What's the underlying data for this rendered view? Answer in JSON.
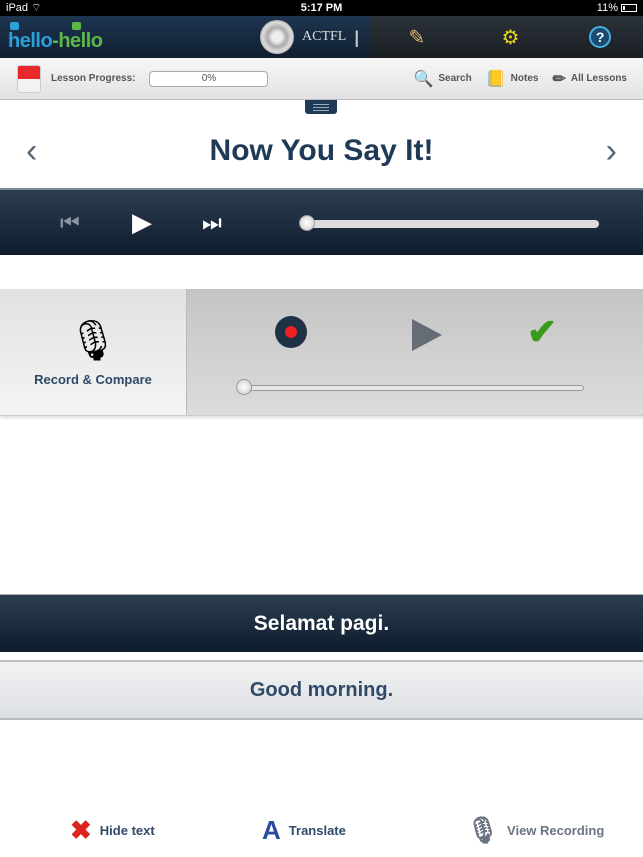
{
  "status_bar": {
    "device": "iPad",
    "time": "5:17 PM",
    "battery": "11%"
  },
  "app": {
    "logo_part1": "hello",
    "logo_dash": "-",
    "logo_part2": "hello",
    "partner": "ACTFL",
    "partner_bars": "|||"
  },
  "toolbar": {
    "lesson_progress_label": "Lesson Progress:",
    "lesson_progress_value": "0%",
    "lesson_progress_fraction": 0,
    "search_label": "Search",
    "notes_label": "Notes",
    "all_lessons_label": "All Lessons"
  },
  "title": {
    "text": "Now You Say It!",
    "prev": "‹",
    "next": "›"
  },
  "player": {
    "position_fraction": 0
  },
  "record_compare": {
    "label": "Record & Compare",
    "position_fraction": 0
  },
  "phrase": {
    "target": "Selamat pagi.",
    "translation": "Good morning."
  },
  "bottom": {
    "hide_text": "Hide text",
    "translate": "Translate",
    "view_recording": "View Recording"
  },
  "colors": {
    "accent": "#1f3a57",
    "record": "#e22222",
    "check": "#3a9a1a"
  }
}
